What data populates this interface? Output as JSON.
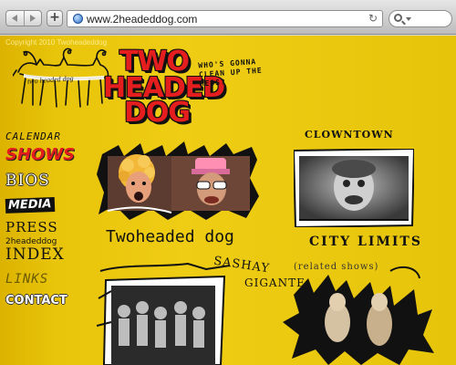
{
  "browser": {
    "url": "www.2headeddog.com",
    "new_tab": "+",
    "reload": "↻"
  },
  "site": {
    "copyright": "Copyright 2010 Twoheadeddog",
    "logo": {
      "tagline": "two headed dog",
      "title_lines": [
        "TWO",
        "HEADED",
        "DOG"
      ],
      "question": "WHO'S GONNA CLEAN UP THE MESS?"
    },
    "nav": {
      "calendar": "CALENDAR",
      "shows": "SHOWS",
      "bios": "BIOS",
      "media": "MEDIA",
      "press": "PRESS",
      "index_prefix": "2headeddog",
      "index": "INDEX",
      "links": "LINKS",
      "contact": "CONTACT"
    },
    "panels": {
      "twoheadeddog_caption": "Twoheaded dog",
      "clowntown_title": "CLOWNTOWN",
      "clowntown_subtitle": "CITY LIMITS",
      "sashay_title": "SASHAY",
      "sashay_vertical": "GIGANTE",
      "related_caption": "(related shows)"
    }
  },
  "colors": {
    "page_bg": "#efcd14",
    "logo_red": "#e41e1e",
    "ink": "#111111"
  }
}
